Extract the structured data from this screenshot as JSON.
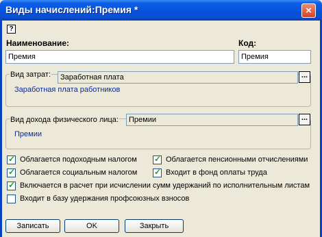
{
  "window": {
    "title": "Виды начислений:Премия *",
    "close_glyph": "×"
  },
  "help_glyph": "?",
  "name": {
    "label": "Наименование:",
    "value": "Премия"
  },
  "code": {
    "label": "Код:",
    "value": "Премия"
  },
  "cost_type": {
    "label": "Вид затрат:",
    "value": "Заработная плата",
    "button": "...",
    "description": "Заработная плата работников"
  },
  "income_type": {
    "label": "Вид дохода физического лица:",
    "value": "Премии",
    "button": "...",
    "description": "Премии"
  },
  "checks": [
    {
      "label": "Облагается подоходным налогом",
      "checked": true
    },
    {
      "label": "Облагается пенсионными отчислениями",
      "checked": true
    },
    {
      "label": "Облагается социальным налогом",
      "checked": true
    },
    {
      "label": "Входит в фонд оплаты труда",
      "checked": true
    },
    {
      "label": "Включается в расчет при исчислении сумм удержаний по исполнительным листам",
      "checked": true
    },
    {
      "label": "Входит в базу удержания профсоюзных взносов",
      "checked": false
    }
  ],
  "buttons": {
    "save": "Записать",
    "ok": "OK",
    "close": "Закрыть"
  },
  "colors": {
    "titlebar": "#0652dd",
    "description_text": "#0a2a9a",
    "checkmark": "#21a121"
  }
}
